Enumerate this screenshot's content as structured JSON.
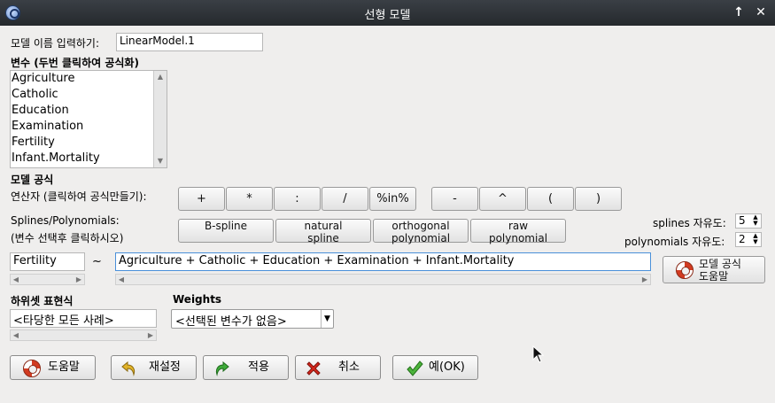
{
  "window": {
    "title": "선형 모델"
  },
  "model_name": {
    "label": "모델 이름 입력하기:",
    "value": "LinearModel.1"
  },
  "variables": {
    "label": "변수 (두번 클릭하여 공식화)",
    "items": [
      "Agriculture",
      "Catholic",
      "Education",
      "Examination",
      "Fertility",
      "Infant.Mortality"
    ]
  },
  "formula_section": {
    "label": "모델 공식",
    "operators_label": "연산자 (클릭하여 공식만들기):",
    "operators": [
      "+",
      "*",
      ":",
      "/",
      "%in%",
      "-",
      "^",
      "(",
      ")"
    ],
    "splines_label": "Splines/Polynomials:",
    "splines_hint": "(변수 선택후 클릭하시오)",
    "spline_buttons": [
      {
        "line1": "B-spline",
        "line2": ""
      },
      {
        "line1": "natural",
        "line2": "spline"
      },
      {
        "line1": "orthogonal",
        "line2": "polynomial"
      },
      {
        "line1": "raw",
        "line2": "polynomial"
      }
    ],
    "splines_df_label": "splines 자유도:",
    "splines_df_value": "5",
    "poly_df_label": "polynomials 자유도:",
    "poly_df_value": "2",
    "lhs": "Fertility",
    "tilde": "~",
    "rhs": "Agriculture + Catholic + Education + Examination + Infant.Mortality",
    "help_button_line1": "모델 공식",
    "help_button_line2": "도움말"
  },
  "subset": {
    "label": "하위셋 표현식",
    "value": "<타당한 모든 사례>"
  },
  "weights": {
    "label": "Weights",
    "value": "<선택된 변수가 없음>"
  },
  "actions": {
    "help": "도움말",
    "reset": "재설정",
    "apply": "적용",
    "cancel": "취소",
    "ok": "예(OK)"
  }
}
